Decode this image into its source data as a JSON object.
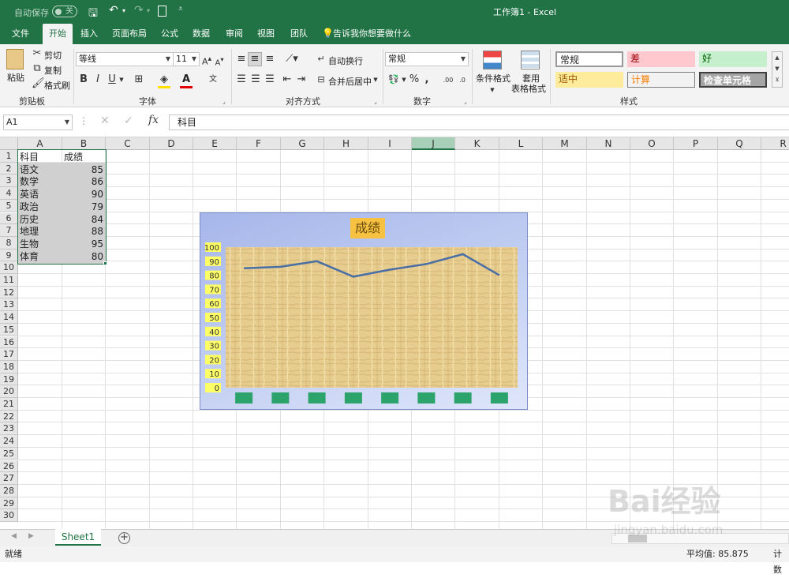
{
  "titlebar": {
    "autosave_label": "自动保存",
    "autosave_state": "关",
    "doc_title": "工作簿1 - Excel"
  },
  "tabs": [
    "文件",
    "开始",
    "插入",
    "页面布局",
    "公式",
    "数据",
    "审阅",
    "视图",
    "团队"
  ],
  "tell_me": "告诉我你想要做什么",
  "ribbon": {
    "paste": "粘贴",
    "cut": "剪切",
    "copy": "复制",
    "format_painter": "格式刷",
    "clipboard": "剪贴板",
    "font_name": "等线",
    "font_size": "11",
    "font_group": "字体",
    "wrap_text": "自动换行",
    "merge_center": "合并后居中",
    "alignment_group": "对齐方式",
    "number_format": "常规",
    "number_group": "数字",
    "conditional_format": "条件格式",
    "table_format_1": "套用",
    "table_format_2": "表格格式",
    "styles_group": "样式",
    "styles": [
      "常规",
      "差",
      "好",
      "适中",
      "计算",
      "检查单元格"
    ]
  },
  "formula_bar": {
    "name_box": "A1",
    "content": "科目"
  },
  "columns": [
    "A",
    "B",
    "C",
    "D",
    "E",
    "F",
    "G",
    "H",
    "I",
    "J",
    "K",
    "L",
    "M",
    "N",
    "O",
    "P",
    "Q",
    "R"
  ],
  "rows": [
    "1",
    "2",
    "3",
    "4",
    "5",
    "6",
    "7",
    "8",
    "9",
    "10",
    "11",
    "12",
    "13",
    "14",
    "15",
    "16",
    "17",
    "18",
    "19",
    "20",
    "21",
    "22",
    "23",
    "24",
    "25",
    "26",
    "27",
    "28",
    "29",
    "30"
  ],
  "table": {
    "headers": [
      "科目",
      "成绩"
    ],
    "rows": [
      [
        "语文",
        "85"
      ],
      [
        "数学",
        "86"
      ],
      [
        "英语",
        "90"
      ],
      [
        "政治",
        "79"
      ],
      [
        "历史",
        "84"
      ],
      [
        "地理",
        "88"
      ],
      [
        "生物",
        "95"
      ],
      [
        "体育",
        "80"
      ]
    ]
  },
  "chart_data": {
    "type": "line",
    "title": "成绩",
    "categories": [
      "",
      "",
      "",
      "",
      "",
      "",
      "",
      ""
    ],
    "series": [
      {
        "values": [
          85,
          86,
          90,
          79,
          84,
          88,
          95,
          80
        ]
      }
    ],
    "y_ticks": [
      "100",
      "90",
      "80",
      "70",
      "60",
      "50",
      "40",
      "30",
      "20",
      "10",
      "0"
    ],
    "ylim": [
      0,
      100
    ],
    "grid": false,
    "line_color": "#4a6fa5"
  },
  "sheet_tab": "Sheet1",
  "status": {
    "ready": "就绪",
    "average": "平均值: 85.875",
    "count": "计数"
  },
  "watermark": {
    "text": "Bai经验",
    "url": "jingyan.baidu.com"
  },
  "colors": {
    "excel_green": "#217346",
    "chart_title_bg": "#f7c242",
    "tick_bg": "#ffff66",
    "category_bg": "#2ca36b"
  }
}
